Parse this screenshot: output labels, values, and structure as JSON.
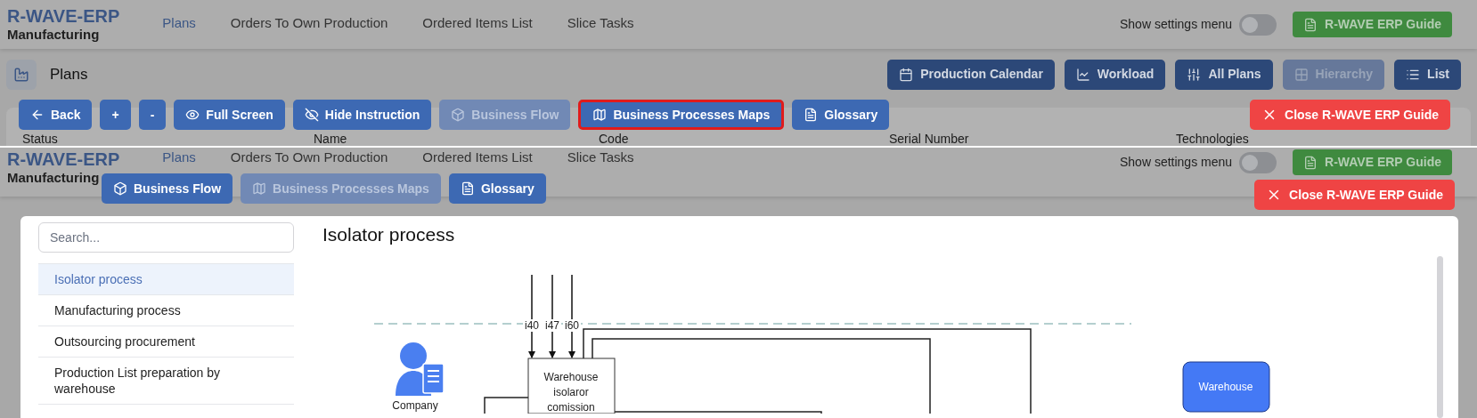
{
  "top_view": {
    "header": {
      "brand": "R-WAVE-ERP",
      "module": "Manufacturing",
      "nav": [
        {
          "label": "Plans",
          "selected": true
        },
        {
          "label": "Orders To Own Production",
          "selected": false
        },
        {
          "label": "Ordered Items List",
          "selected": false
        },
        {
          "label": "Slice Tasks",
          "selected": false
        }
      ],
      "settings_label": "Show settings menu",
      "settings_on": false,
      "guide_button": "R-WAVE ERP Guide"
    },
    "page_title": "Plans",
    "actions": [
      {
        "label": "Production Calendar",
        "disabled": false
      },
      {
        "label": "Workload",
        "disabled": false
      },
      {
        "label": "All Plans",
        "disabled": false
      },
      {
        "label": "Hierarchy",
        "disabled": true
      },
      {
        "label": "List",
        "disabled": false
      }
    ],
    "guide_toolbar": [
      {
        "label": "Back",
        "disabled": false,
        "highlighted": false
      },
      {
        "label": "+",
        "disabled": false,
        "highlighted": false
      },
      {
        "label": "-",
        "disabled": false,
        "highlighted": false
      },
      {
        "label": "Full Screen",
        "disabled": false,
        "highlighted": false
      },
      {
        "label": "Hide Instruction",
        "disabled": false,
        "highlighted": false
      },
      {
        "label": "Business Flow",
        "disabled": true,
        "highlighted": false
      },
      {
        "label": "Business Processes Maps",
        "disabled": false,
        "highlighted": true
      },
      {
        "label": "Glossary",
        "disabled": false,
        "highlighted": false
      }
    ],
    "close_button": "Close R-WAVE ERP Guide",
    "table_columns": [
      "Status",
      "Name",
      "Code",
      "Serial Number",
      "Technologies"
    ]
  },
  "bottom_view": {
    "header": {
      "brand": "R-WAVE-ERP",
      "module": "Manufacturing",
      "nav": [
        {
          "label": "Plans",
          "selected": true
        },
        {
          "label": "Orders To Own Production",
          "selected": false
        },
        {
          "label": "Ordered Items List",
          "selected": false
        },
        {
          "label": "Slice Tasks",
          "selected": false
        }
      ],
      "settings_label": "Show settings menu",
      "settings_on": false,
      "guide_button": "R-WAVE ERP Guide"
    },
    "guide_toolbar": [
      {
        "label": "Business Flow",
        "disabled": false,
        "highlighted": false
      },
      {
        "label": "Business Processes Maps",
        "disabled": true,
        "highlighted": false
      },
      {
        "label": "Glossary",
        "disabled": false,
        "highlighted": false
      }
    ],
    "close_button": "Close R-WAVE ERP Guide",
    "modal": {
      "search": {
        "placeholder": "Search..."
      },
      "processes": [
        {
          "label": "Isolator process",
          "selected": true
        },
        {
          "label": "Manufacturing process",
          "selected": false
        },
        {
          "label": "Outsourcing procurement",
          "selected": false
        },
        {
          "label": "Production List preparation by warehouse",
          "selected": false
        }
      ],
      "title": "Isolator process",
      "diagram": {
        "inputs": [
          "i40",
          "i47",
          "i60"
        ],
        "process": "Warehouse isolaror comission",
        "actor": "Company",
        "target": "Warehouse"
      }
    }
  }
}
